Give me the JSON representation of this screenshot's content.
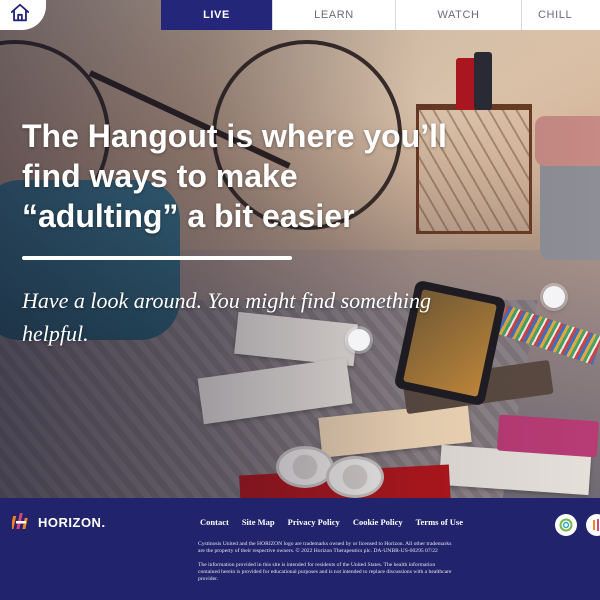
{
  "nav": {
    "home_icon": "home-icon",
    "tabs": [
      {
        "label": "LIVE",
        "active": true
      },
      {
        "label": "LEARN",
        "active": false
      },
      {
        "label": "WATCH",
        "active": false
      },
      {
        "label": "CHILL",
        "active": false
      }
    ]
  },
  "hero": {
    "headline": "The Hangout is where you’ll find ways to make “adulting” a bit easier",
    "subhead": "Have a look around. You might find something helpful."
  },
  "footer": {
    "logo_text": "HORIZON.",
    "links": [
      "Contact",
      "Site Map",
      "Privacy Policy",
      "Cookie Policy",
      "Terms of Use"
    ],
    "legal_1": "Cystinosis United and the HORIZON logo are trademarks owned by or licensed to Horizon. All other trademarks are the property of their respective owners. © 2022 Horizon Therapeutics plc. DA-UNBR-US-00295 07/22",
    "legal_2": "The information provided in this site is intended for residents of the United States. The health information contained herein is provided for educational purposes and is not intended to replace discussions with a healthcare provider."
  },
  "colors": {
    "nav_active": "#24267a",
    "footer_bg": "#21246c",
    "brand_orange": "#f58220",
    "brand_pink": "#d2457f"
  }
}
